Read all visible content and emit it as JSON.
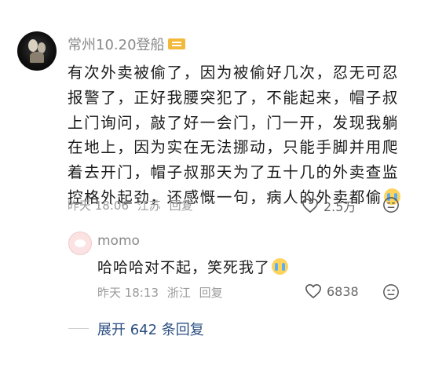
{
  "comment": {
    "username": "常州10.20登船",
    "username_badge_icon": "ticket-icon",
    "lines": [
      "有次外卖被偷了，因为被偷好几次，忍无可忍",
      "报警了，正好我腰突犯了，不能起来，帽子叔",
      "上门询问，敲了好一会门，门一开，发现我躺",
      "在地上，因为实在无法挪动，只能手脚并用爬",
      "着去开门，帽子叔那天为了五十几的外卖查监",
      "控格外起劲，还感慨一句，病人的外卖都偷"
    ],
    "trailing_emoji": "crying-emoji",
    "date": "昨天 18:06",
    "location": "江苏",
    "reply_label": "回复",
    "likes": "2.5万"
  },
  "reply": {
    "username": "momo",
    "text": "哈哈哈对不起，笑死我了",
    "trailing_emoji": "crying-emoji",
    "date": "昨天 18:13",
    "location": "浙江",
    "reply_label": "回复",
    "likes": "6838"
  },
  "expand": {
    "label": "展开 642 条回复"
  },
  "colors": {
    "link": "#2c4f82",
    "meta": "#9a9a9a",
    "badge": "#f2b93a"
  }
}
